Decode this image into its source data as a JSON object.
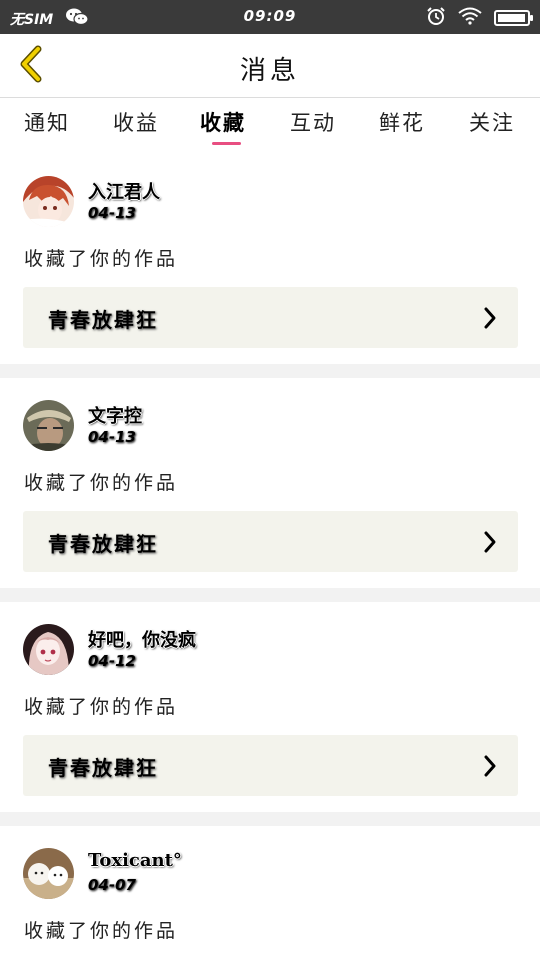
{
  "status_bar": {
    "carrier": "无SIM",
    "time": "09:09",
    "icons": [
      "wechat-icon",
      "alarm-icon",
      "wifi-icon",
      "battery-icon"
    ],
    "battery_level": 0.95
  },
  "header": {
    "title": "消息",
    "back_icon": "chevron-left-icon",
    "accent_color": "#e0c000"
  },
  "tabs": [
    {
      "label": "通知"
    },
    {
      "label": "收益"
    },
    {
      "label": "收藏",
      "active": true
    },
    {
      "label": "互动"
    },
    {
      "label": "鲜花"
    },
    {
      "label": "关注"
    }
  ],
  "tab_indicator_color": "#e84e81",
  "items": [
    {
      "username": "入江君人",
      "date": "04-13",
      "action": "收藏了你的作品",
      "work_title": "青春放肆狂",
      "avatar": "anime-avatar-redhair"
    },
    {
      "username": "文字控",
      "date": "04-13",
      "action": "收藏了你的作品",
      "work_title": "青春放肆狂",
      "avatar": "photo-avatar-hat"
    },
    {
      "username": "好吧，你没疯",
      "date": "04-12",
      "action": "收藏了你的作品",
      "work_title": "青春放肆狂",
      "avatar": "anime-avatar-girl"
    },
    {
      "username": "Toxicant°",
      "date": "04-07",
      "action": "收藏了你的作品",
      "work_title": "",
      "avatar": "photo-avatar-dogs"
    }
  ]
}
